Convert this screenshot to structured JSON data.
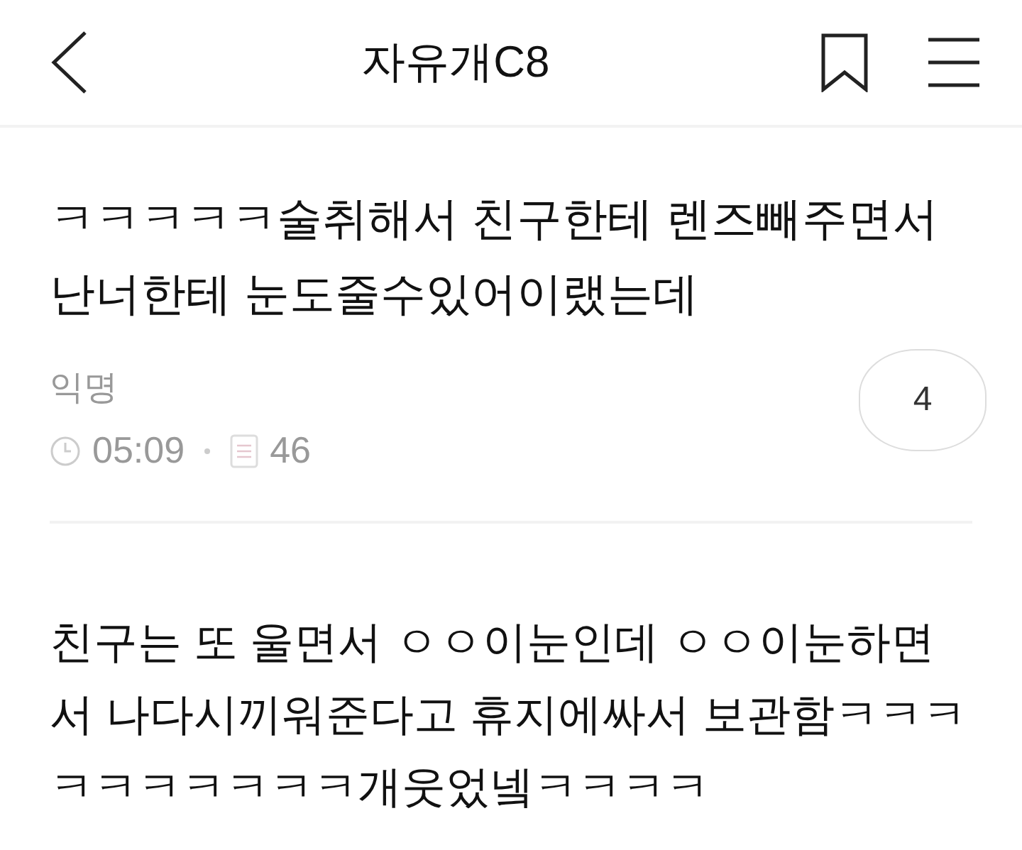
{
  "header": {
    "title": "자유개C8"
  },
  "post": {
    "title": "ㅋㅋㅋㅋㅋ술취해서 친구한테 렌즈빼주면서 난너한테 눈도줄수있어이랬는데",
    "author": "익명",
    "time": "05:09",
    "views": "46",
    "comments": "4",
    "body": "친구는 또 울면서 ㅇㅇ이눈인데 ㅇㅇ이눈하면서 나다시끼워준다고 휴지에싸서 보관함ㅋㅋㅋㅋㅋㅋㅋㅋㅋㅋ개웃었넼ㅋㅋㅋㅋ"
  }
}
